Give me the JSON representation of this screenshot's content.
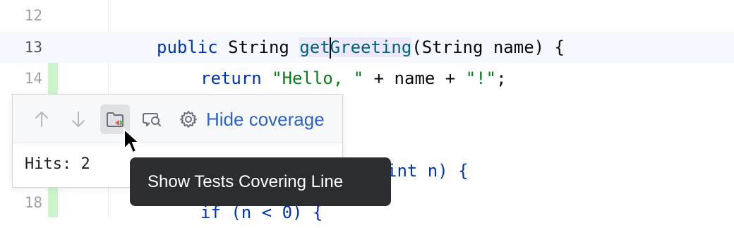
{
  "editor": {
    "lines": [
      {
        "number": "12",
        "code_plain": ""
      },
      {
        "number": "13",
        "kw1": "public",
        "type1": "String",
        "fn_pre": "get",
        "fn_post": "Greeting",
        "rest": "(String name) {"
      },
      {
        "number": "14",
        "kw": "return",
        "str1": "\"Hello, \"",
        "mid": " + name + ",
        "str2": "\"!\"",
        "end": ";"
      },
      {
        "number": "18",
        "code_fragment": "if (n < 0) {"
      }
    ],
    "partial_code_line": "int n) {"
  },
  "coverage_popup": {
    "toolbar": {
      "prev_label": "Previous",
      "next_label": "Next",
      "show_tests_icon": "folder-tests-icon",
      "hide_coverage_label": "Hide coverage"
    },
    "hits_text": "Hits: 2"
  },
  "tooltip": {
    "text": "Show Tests Covering Line"
  },
  "colors": {
    "keyword": "#0033b3",
    "function": "#00627a",
    "string": "#067d17",
    "coverage_covered": "#ccf5cc",
    "link": "#2e62c4",
    "tooltip_bg": "#2b2d30"
  }
}
